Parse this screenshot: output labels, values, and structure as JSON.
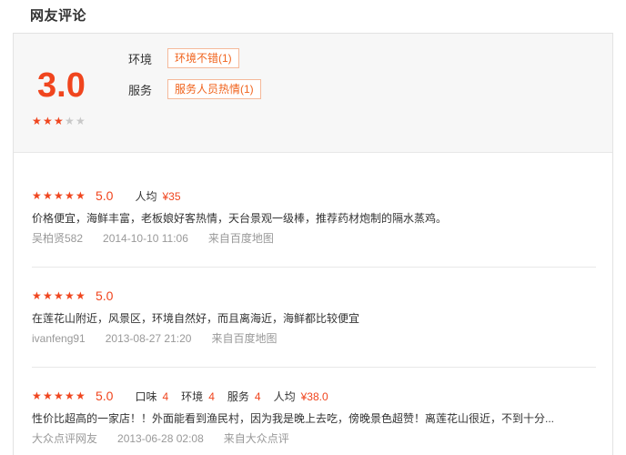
{
  "section_title": "网友评论",
  "summary": {
    "score": "3.0",
    "stars": {
      "filled": 3,
      "total": 5
    },
    "tags": [
      {
        "label": "环境",
        "tag": "环境不错(1)"
      },
      {
        "label": "服务",
        "tag": "服务人员热情(1)"
      }
    ]
  },
  "reviews": [
    {
      "rating": "5.0",
      "stars": {
        "filled": 5,
        "total": 5
      },
      "meta": [
        {
          "label": "人均",
          "value": "¥35"
        }
      ],
      "text": "价格便宜，海鲜丰富，老板娘好客热情，天台景观一级棒，推荐药材炮制的隔水蒸鸡。",
      "user": "吴柏贤582",
      "time": "2014-10-10 11:06",
      "source": "来自百度地图"
    },
    {
      "rating": "5.0",
      "stars": {
        "filled": 5,
        "total": 5
      },
      "meta": [],
      "text": "在莲花山附近，风景区，环境自然好，而且离海近，海鲜都比较便宜",
      "user": "ivanfeng91",
      "time": "2013-08-27 21:20",
      "source": "来自百度地图"
    },
    {
      "rating": "5.0",
      "stars": {
        "filled": 5,
        "total": 5
      },
      "meta": [
        {
          "label": "口味",
          "value": "4"
        },
        {
          "label": "环境",
          "value": "4"
        },
        {
          "label": "服务",
          "value": "4"
        },
        {
          "label": "人均",
          "value": "¥38.0"
        }
      ],
      "text": "性价比超高的一家店！！外面能看到渔民村，因为我是晚上去吃，傍晚景色超赞！离莲花山很近，不到十分...",
      "user": "大众点评网友",
      "time": "2013-06-28 02:08",
      "source": "来自大众点评"
    }
  ],
  "colors": {
    "accent": "#f0451e",
    "tag_text": "#f0641e",
    "muted": "#999999"
  }
}
